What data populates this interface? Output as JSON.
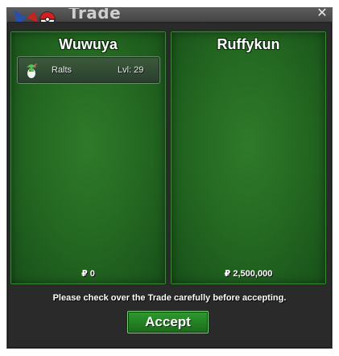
{
  "window": {
    "title": "Trade",
    "close_icon": "close-icon"
  },
  "left_panel": {
    "player_name": "Wuwuya",
    "pokemon": [
      {
        "name": "Ralts",
        "level": "Lvl: 29",
        "sprite_icon": "ralts-sprite-icon"
      }
    ],
    "money": "₽ 0"
  },
  "right_panel": {
    "player_name": "Ruffykun",
    "pokemon": [],
    "money": "₽ 2,500,000"
  },
  "notice": "Please check over the Trade carefully before accepting.",
  "accept_button": "Accept",
  "colors": {
    "panel_green": "#256a22",
    "accept_green": "#2f9a2f",
    "window_bg": "#2a2a2a"
  }
}
